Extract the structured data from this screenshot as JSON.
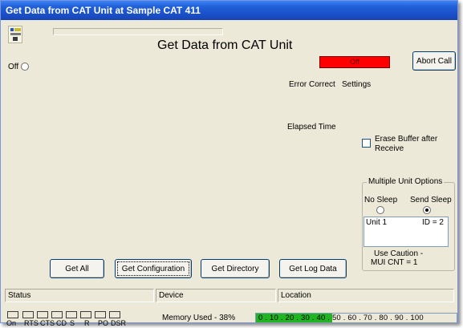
{
  "window": {
    "title": "Get Data from  CAT Unit at Sample CAT 411"
  },
  "main": {
    "heading": "Get Data from CAT Unit",
    "connection": {
      "label": "Off"
    },
    "status_indicator": {
      "text": "Off",
      "color": "#ff0000"
    },
    "abort_button": "Abort Call",
    "error_correct_label": "Error Correct",
    "settings_label": "Settings",
    "elapsed_time_label": "Elapsed Time",
    "erase_buffer": {
      "line1": "Erase Buffer after",
      "line2": "Receive",
      "checked": false
    }
  },
  "multi_unit": {
    "title": "Multiple Unit Options",
    "no_sleep": "No Sleep",
    "send_sleep": "Send Sleep",
    "selected": "Send Sleep",
    "list": [
      {
        "unit": "Unit 1",
        "id": "ID = 2"
      }
    ],
    "caution_line1": "Use Caution -",
    "caution_line2": "MUI CNT = 1"
  },
  "actions": {
    "get_all": "Get All",
    "get_configuration": "Get Configuration",
    "get_directory": "Get Directory",
    "get_log_data": "Get Log Data"
  },
  "statusbar": {
    "status": "Status",
    "device": "Device",
    "location": "Location"
  },
  "leds": [
    "On",
    "RTS",
    "CTS",
    "CD",
    "S",
    "R",
    "PO",
    "DSR"
  ],
  "memory": {
    "label": "Memory Used - 38%",
    "percent": 38,
    "scale": "0 . 10 . 20 . 30 . 40 . 50 . 60 . 70 . 80 . 90 . 100",
    "fill_color": "#22b522"
  }
}
